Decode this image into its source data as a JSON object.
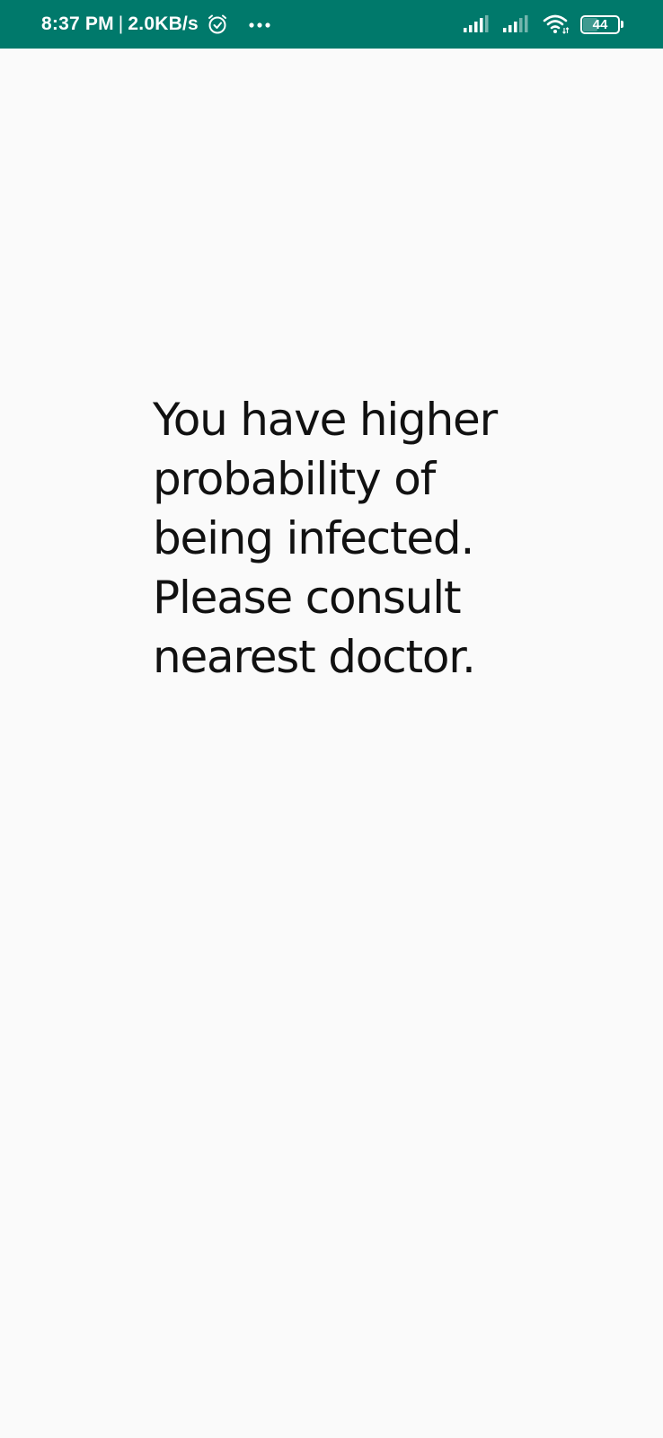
{
  "status_bar": {
    "time": "8:37 PM",
    "separator": "|",
    "network_speed": "2.0KB/s",
    "battery_level": "44",
    "battery_fraction": 0.44,
    "icons": [
      "alarm-clock-icon",
      "more-dots-icon",
      "signal-sim1-icon",
      "signal-sim2-icon",
      "wifi-icon",
      "battery-icon"
    ],
    "background_color": "#00796b"
  },
  "main": {
    "message": "You have higher probability of being infected. Please consult nearest doctor.",
    "background_color": "#fafafa",
    "text_color": "#111111"
  }
}
